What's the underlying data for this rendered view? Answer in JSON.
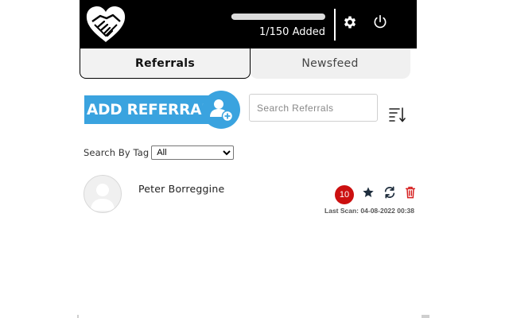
{
  "header": {
    "progress": {
      "added": 1,
      "limit": 150,
      "label": "1/150 Added"
    }
  },
  "tabs": [
    {
      "label": "Referrals",
      "active": true
    },
    {
      "label": "Newsfeed",
      "active": false
    }
  ],
  "toolbar": {
    "add_label": "ADD REFERRAL",
    "search_placeholder": "Search Referrals",
    "search_value": ""
  },
  "filter": {
    "label": "Search By Tag",
    "selected": "All",
    "options": [
      "All"
    ]
  },
  "referrals": [
    {
      "name": "Peter Borreggine",
      "score": "10",
      "last_scan_label": "Last Scan:",
      "last_scan_value": "04-08-2022 00:38"
    }
  ],
  "icons": {
    "logo": "heart-handshake-icon",
    "settings": "gear-icon",
    "power": "power-icon",
    "add_user": "add-user-icon",
    "sort": "sort-icon",
    "star": "star-icon",
    "refresh": "refresh-icon",
    "trash": "trash-icon"
  },
  "colors": {
    "header_bg": "#000000",
    "accent": "#3aa3df",
    "badge": "#cc1010",
    "trash": "#d62020"
  }
}
